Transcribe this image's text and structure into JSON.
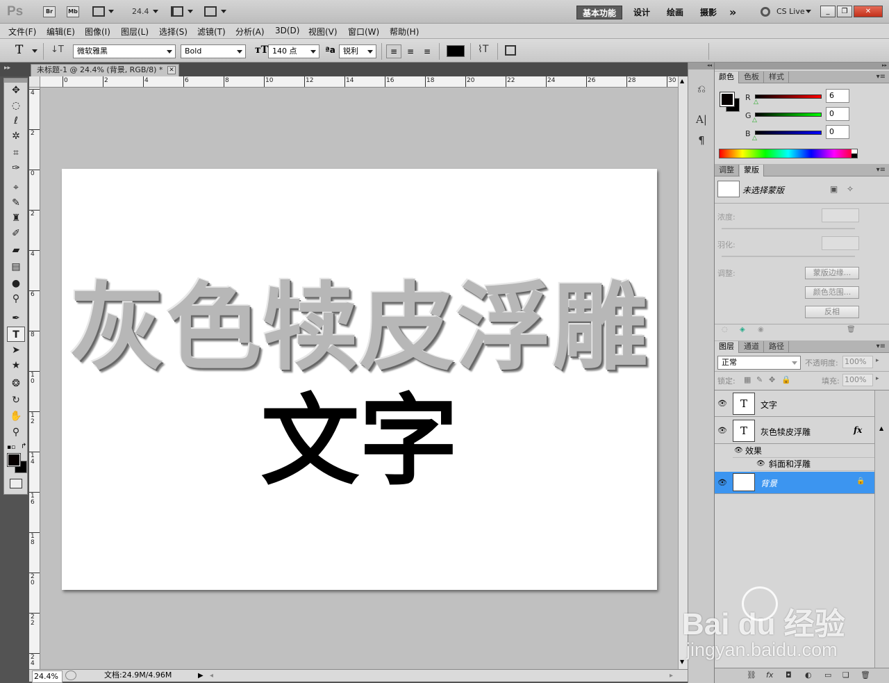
{
  "app": {
    "logo": "Ps",
    "bridge_label": "Br",
    "minibridge_label": "Mb",
    "zoom": "24.4",
    "workspaces": [
      "基本功能",
      "设计",
      "绘画",
      "摄影"
    ],
    "more_label": "»",
    "cslive": "CS Live"
  },
  "menu": [
    "文件(F)",
    "编辑(E)",
    "图像(I)",
    "图层(L)",
    "选择(S)",
    "滤镜(T)",
    "分析(A)",
    "3D(D)",
    "视图(V)",
    "窗口(W)",
    "帮助(H)"
  ],
  "options": {
    "tool_icon": "T",
    "font_family": "微软雅黑",
    "font_style": "Bold",
    "font_size": "140 点",
    "aa_label": "ªa",
    "antialias": "锐利",
    "text_color": "#000000"
  },
  "document": {
    "tab_title": "未标题-1 @ 24.4% (背景, RGB/8) *",
    "embossed_text": "灰色犊皮浮雕",
    "plain_text": "文字",
    "ruler_h": [
      "0",
      "2",
      "4",
      "6",
      "8",
      "10",
      "12",
      "14",
      "16",
      "18",
      "20",
      "22",
      "24",
      "26",
      "28",
      "30"
    ],
    "ruler_v": [
      "4",
      "2",
      "0",
      "2",
      "4",
      "6",
      "8",
      "1\n0",
      "1\n2",
      "1\n4",
      "1\n6",
      "1\n8",
      "2\n0",
      "2\n2",
      "2\n4"
    ]
  },
  "status": {
    "zoom": "24.4%",
    "doc_size": "文档:24.9M/4.96M"
  },
  "color_panel": {
    "tabs": [
      "颜色",
      "色板",
      "样式"
    ],
    "r_label": "R",
    "g_label": "G",
    "b_label": "B",
    "r": "6",
    "g": "0",
    "b": "0",
    "fg": "#060000",
    "bg": "#000000"
  },
  "masks_panel": {
    "tabs": [
      "调整",
      "蒙版"
    ],
    "title": "未选择蒙版",
    "density_label": "浓度:",
    "feather_label": "羽化:",
    "adjust_label": "调整:",
    "btn_edge": "蒙版边缘...",
    "btn_range": "颜色范围...",
    "btn_invert": "反相"
  },
  "layers_panel": {
    "tabs": [
      "图层",
      "通道",
      "路径"
    ],
    "blend_mode": "正常",
    "opacity_label": "不透明度:",
    "opacity": "100%",
    "lock_label": "锁定:",
    "fill_label": "填充:",
    "fill": "100%",
    "layers": [
      {
        "name": "文字",
        "thumb": "T"
      },
      {
        "name": "灰色犊皮浮雕",
        "thumb": "T",
        "fx": "fx"
      }
    ],
    "effects_label": "效果",
    "effect_item": "斜面和浮雕",
    "background_layer": "背景"
  },
  "watermark": {
    "brand": "Bai  du 经验",
    "url": "jingyan.baidu.com"
  }
}
